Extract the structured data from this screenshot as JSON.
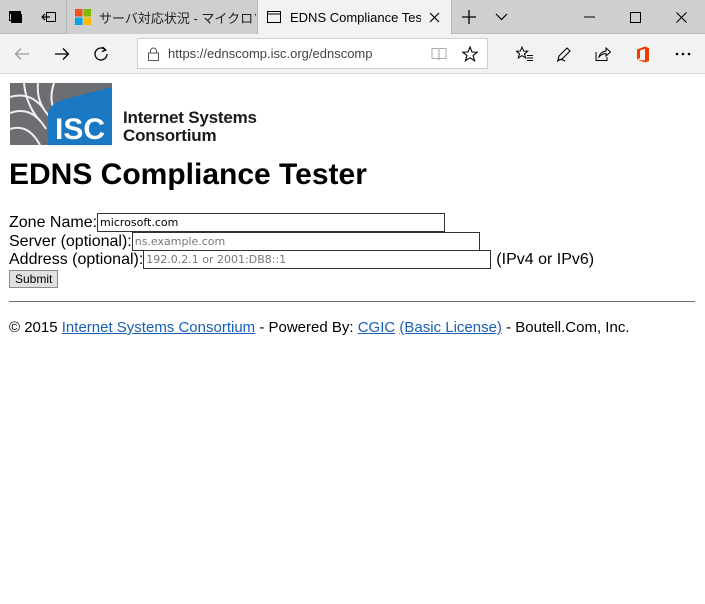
{
  "browser": {
    "tabs": [
      {
        "title": "サーバ対応状況 - マイクロソフ",
        "active": false
      },
      {
        "title": "EDNS Compliance Test",
        "active": true
      }
    ],
    "url": "https://ednscomp.isc.org/ednscomp",
    "accent_colors": {
      "ms_red": "#f25022",
      "ms_green": "#7fba00",
      "ms_blue": "#00a4ef",
      "ms_yellow": "#ffb900",
      "office": "#eb3c00"
    },
    "icons": [
      "tab-actions-icon",
      "set-aside-tabs-icon",
      "new-tab-icon",
      "tab-list-chevron-icon",
      "minimize-icon",
      "maximize-icon",
      "close-window-icon",
      "back-icon",
      "forward-icon",
      "refresh-icon",
      "lock-icon",
      "reading-view-icon",
      "favorite-star-icon",
      "favorites-hub-icon",
      "pen-icon",
      "share-icon",
      "office-icon",
      "more-icon"
    ]
  },
  "logo": {
    "abbr": "ISC",
    "line1": "Internet Systems",
    "line2": "Consortium",
    "brand_blue": "#1a78c2"
  },
  "page": {
    "title": "EDNS Compliance Tester",
    "form": {
      "zone_label": "Zone Name:",
      "zone_value": "microsoft.com",
      "server_label": "Server (optional):",
      "server_placeholder": "ns.example.com",
      "address_label": "Address (optional):",
      "address_placeholder": "192.0.2.1 or 2001:DB8::1",
      "address_hint": "(IPv4 or IPv6)",
      "submit_label": "Submit"
    },
    "footer": {
      "copyright": "© 2015",
      "isc_link": "Internet Systems Consortium",
      "powered_by": " - Powered By: ",
      "cgic_link": "CGIC",
      "license_link": "(Basic License)",
      "tail": " - Boutell.Com, Inc."
    }
  }
}
